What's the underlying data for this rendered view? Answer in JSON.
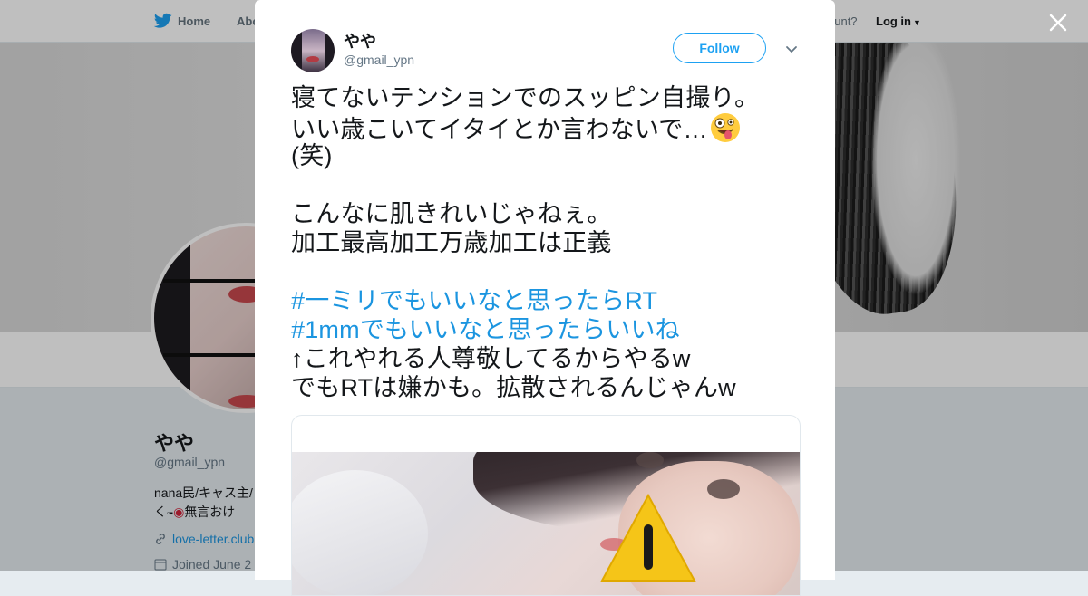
{
  "nav": {
    "home_label": "Home",
    "about_label": "Abo",
    "account_prompt": "ccount?",
    "login_label": "Log in"
  },
  "profile": {
    "name": "やや",
    "handle": "@gmail_ypn",
    "bio_line1": "nana民/キャス主/",
    "bio_line2": "く",
    "bio_line2_tail": "無言おけ",
    "url": "love-letter.club",
    "joined": "Joined June 2"
  },
  "tweet": {
    "author_name": "やや",
    "author_handle": "@gmail_ypn",
    "follow_label": "Follow",
    "lines": {
      "l1": "寝てないテンションでのスッピン自撮り。",
      "l2": "いい歳こいてイタイとか言わないで…",
      "l3": "(笑)",
      "l4": "こんなに肌きれいじゃねぇ。",
      "l5": "加工最高加工万歳加工は正義",
      "h1": "#一ミリでもいいなと思ったらRT",
      "h2": "#1mmでもいいなと思ったらいいね",
      "l6": "↑これやれる人尊敬してるからやるw",
      "l7": "でもRTは嫌かも。拡散されるんじゃんw"
    }
  },
  "icons": {
    "bird": "twitter-bird-icon",
    "close": "close-icon",
    "caret": "chevron-down-icon",
    "link": "link-icon",
    "calendar": "calendar-icon",
    "emoji": "zany-face-icon",
    "warning": "warning-icon"
  },
  "colors": {
    "accent": "#1da1f2",
    "link": "#1b95e0",
    "text": "#14171a",
    "muted": "#657786",
    "warning": "#f5c518"
  }
}
